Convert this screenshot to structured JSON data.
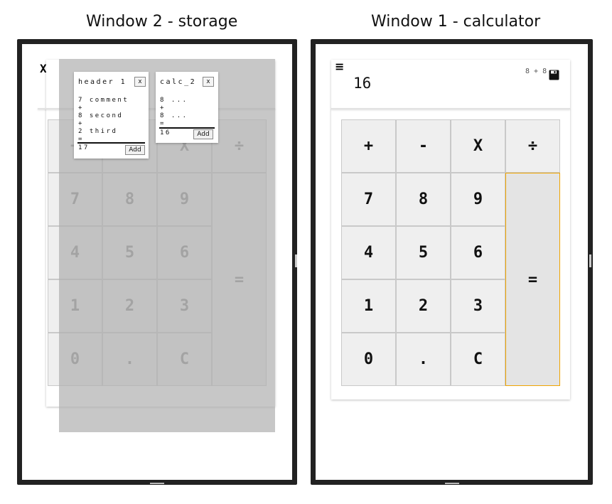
{
  "window2": {
    "title": "Window 2 - storage",
    "close_label": "X",
    "calculator": {
      "display": "",
      "buttons": [
        [
          "+",
          "-",
          "X",
          "÷"
        ],
        [
          "7",
          "8",
          "9"
        ],
        [
          "4",
          "5",
          "6"
        ],
        [
          "1",
          "2",
          "3"
        ],
        [
          "0",
          ".",
          "C"
        ]
      ],
      "equals": "="
    },
    "notes": [
      {
        "header": "header 1",
        "close": "x",
        "lines": [
          "7 comment",
          "+",
          "8 second",
          "+",
          "2 third",
          "="
        ],
        "result": "17",
        "add_label": "Add"
      },
      {
        "header": "calc_2",
        "close": "x",
        "lines": [
          "8 ...",
          "+",
          "8 ...",
          "="
        ],
        "result": "16",
        "add_label": "Add"
      }
    ]
  },
  "window1": {
    "title": "Window 1 - calculator",
    "menu_icon": "≡",
    "display": "16",
    "history": "8 + 8",
    "save_icon": "floppy-disk-icon",
    "buttons": [
      [
        "+",
        "-",
        "X",
        "÷"
      ],
      [
        "7",
        "8",
        "9"
      ],
      [
        "4",
        "5",
        "6"
      ],
      [
        "1",
        "2",
        "3"
      ],
      [
        "0",
        ".",
        "C"
      ]
    ],
    "equals": "="
  },
  "colors": {
    "frame": "#222222",
    "button_bg": "#efefef",
    "equals_border": "#f0a500",
    "overlay": "#afafaf"
  }
}
